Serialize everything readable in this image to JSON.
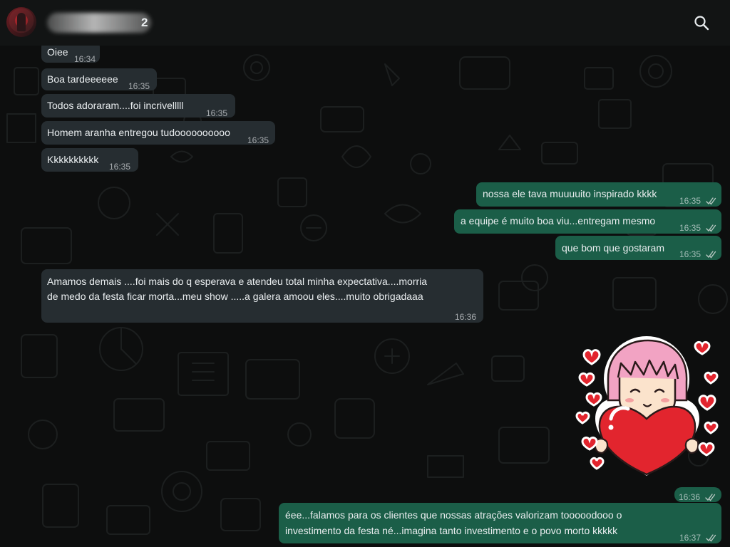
{
  "header": {
    "contact_name_suffix": "2",
    "search_icon": "search-icon"
  },
  "messages": [
    {
      "id": "m1",
      "dir": "in",
      "text": "Oiee",
      "time": "16:34"
    },
    {
      "id": "m2",
      "dir": "in",
      "text": "Boa tardeeeeee",
      "time": "16:35"
    },
    {
      "id": "m3",
      "dir": "in",
      "text": "Todos adoraram....foi incrivelllll",
      "time": "16:35"
    },
    {
      "id": "m4",
      "dir": "in",
      "text": "Homem aranha entregou tudoooooooooo",
      "time": "16:35"
    },
    {
      "id": "m5",
      "dir": "in",
      "text": "Kkkkkkkkkk",
      "time": "16:35"
    },
    {
      "id": "m6",
      "dir": "out",
      "text": "nossa ele tava muuuuito inspirado kkkk",
      "time": "16:35"
    },
    {
      "id": "m7",
      "dir": "out",
      "text": "a equipe é muito boa viu...entregam mesmo",
      "time": "16:35"
    },
    {
      "id": "m8",
      "dir": "out",
      "text": "que bom que gostaram",
      "time": "16:35"
    },
    {
      "id": "m9",
      "dir": "in",
      "line1": "Amamos demais ....foi mais do q esperava e atendeu total minha expectativa....morria",
      "line2": "de medo da festa ficar morta...meu show .....a galera amoou eles....muito obrigadaaa",
      "time": "16:36"
    },
    {
      "id": "m10",
      "dir": "out",
      "sticker": "girl-hugging-heart-sticker",
      "time": "16:36"
    },
    {
      "id": "m11",
      "dir": "out",
      "line1": "éee...falamos para os clientes que nossas atrações valorizam tooooodooo o",
      "line2": "investimento da festa né...imagina tanto investimento e o povo morto kkkkk",
      "time": "16:37"
    }
  ],
  "colors": {
    "incoming_bubble": "#202c33",
    "outgoing_bubble": "#1b5e48",
    "background": "#0d0e0e",
    "header": "#121414"
  }
}
